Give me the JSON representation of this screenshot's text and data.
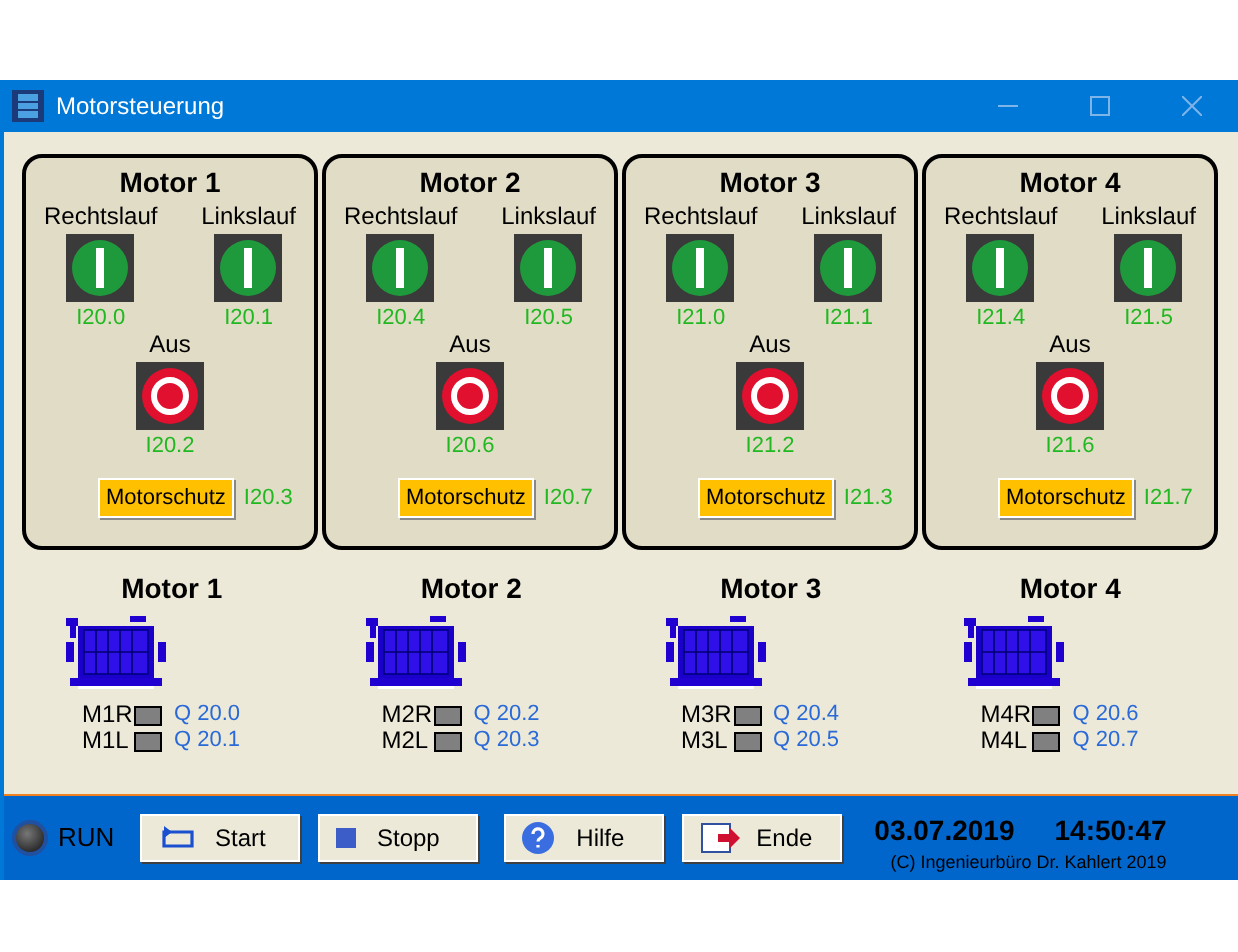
{
  "window": {
    "title": "Motorsteuerung"
  },
  "panels": [
    {
      "title": "Motor 1",
      "buttons": [
        {
          "label": "Rechtslauf",
          "kind": "start",
          "address": "I20.0"
        },
        {
          "label": "Linkslauf",
          "kind": "start",
          "address": "I20.1"
        },
        {
          "label": "Aus",
          "kind": "stop",
          "address": "I20.2"
        }
      ],
      "protection": {
        "label": "Motorschutz",
        "address": "I20.3"
      }
    },
    {
      "title": "Motor 2",
      "buttons": [
        {
          "label": "Rechtslauf",
          "kind": "start",
          "address": "I20.4"
        },
        {
          "label": "Linkslauf",
          "kind": "start",
          "address": "I20.5"
        },
        {
          "label": "Aus",
          "kind": "stop",
          "address": "I20.6"
        }
      ],
      "protection": {
        "label": "Motorschutz",
        "address": "I20.7"
      }
    },
    {
      "title": "Motor 3",
      "buttons": [
        {
          "label": "Rechtslauf",
          "kind": "start",
          "address": "I21.0"
        },
        {
          "label": "Linkslauf",
          "kind": "start",
          "address": "I21.1"
        },
        {
          "label": "Aus",
          "kind": "stop",
          "address": "I21.2"
        }
      ],
      "protection": {
        "label": "Motorschutz",
        "address": "I21.3"
      }
    },
    {
      "title": "Motor 4",
      "buttons": [
        {
          "label": "Rechtslauf",
          "kind": "start",
          "address": "I21.4"
        },
        {
          "label": "Linkslauf",
          "kind": "start",
          "address": "I21.5"
        },
        {
          "label": "Aus",
          "kind": "stop",
          "address": "I21.6"
        }
      ],
      "protection": {
        "label": "Motorschutz",
        "address": "I21.7"
      }
    }
  ],
  "motors": [
    {
      "title": "Motor 1",
      "outputs": [
        {
          "label": "M1R",
          "on": false,
          "address": "Q 20.0"
        },
        {
          "label": "M1L",
          "on": false,
          "address": "Q 20.1"
        }
      ]
    },
    {
      "title": "Motor 2",
      "outputs": [
        {
          "label": "M2R",
          "on": false,
          "address": "Q 20.2"
        },
        {
          "label": "M2L",
          "on": false,
          "address": "Q 20.3"
        }
      ]
    },
    {
      "title": "Motor 3",
      "outputs": [
        {
          "label": "M3R",
          "on": false,
          "address": "Q 20.4"
        },
        {
          "label": "M3L",
          "on": false,
          "address": "Q 20.5"
        }
      ]
    },
    {
      "title": "Motor 4",
      "outputs": [
        {
          "label": "M4R",
          "on": false,
          "address": "Q 20.6"
        },
        {
          "label": "M4L",
          "on": false,
          "address": "Q 20.7"
        }
      ]
    }
  ],
  "status": {
    "label": "RUN",
    "on": false
  },
  "toolbar": [
    {
      "label": "Start",
      "kind": "start"
    },
    {
      "label": "Stopp",
      "kind": "stop"
    },
    {
      "label": "Hilfe",
      "kind": "help"
    },
    {
      "label": "Ende",
      "kind": "exit"
    }
  ],
  "date": "03.07.2019",
  "time": "14:50:47",
  "copyright": "(C) Ingenieurbüro Dr. Kahlert 2019"
}
